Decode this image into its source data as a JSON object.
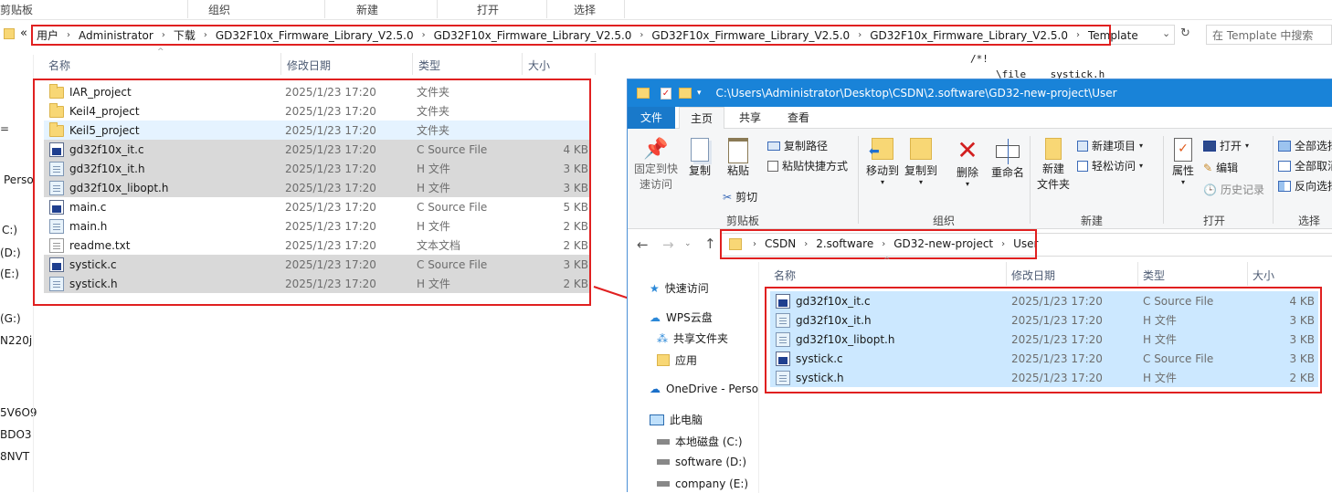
{
  "back_window": {
    "ribbon_groups": [
      "剪贴板",
      "组织",
      "新建",
      "打开",
      "选择"
    ],
    "address_prefix": "«",
    "breadcrumb": [
      "用户",
      "Administrator",
      "下载",
      "GD32F10x_Firmware_Library_V2.5.0",
      "GD32F10x_Firmware_Library_V2.5.0",
      "GD32F10x_Firmware_Library_V2.5.0",
      "GD32F10x_Firmware_Library_V2.5.0",
      "Template"
    ],
    "search_placeholder": "在 Template 中搜索",
    "columns": {
      "name": "名称",
      "date": "修改日期",
      "type": "类型",
      "size": "大小"
    },
    "files": [
      {
        "name": "IAR_project",
        "date": "2025/1/23 17:20",
        "type": "文件夹",
        "size": "",
        "icon": "folder-icon",
        "state": "normal"
      },
      {
        "name": "Keil4_project",
        "date": "2025/1/23 17:20",
        "type": "文件夹",
        "size": "",
        "icon": "folder-icon",
        "state": "normal"
      },
      {
        "name": "Keil5_project",
        "date": "2025/1/23 17:20",
        "type": "文件夹",
        "size": "",
        "icon": "folder-icon",
        "state": "hover"
      },
      {
        "name": "gd32f10x_it.c",
        "date": "2025/1/23 17:20",
        "type": "C Source File",
        "size": "4 KB",
        "icon": "c-source-icon",
        "state": "selected"
      },
      {
        "name": "gd32f10x_it.h",
        "date": "2025/1/23 17:20",
        "type": "H 文件",
        "size": "3 KB",
        "icon": "h-file-icon",
        "state": "selected"
      },
      {
        "name": "gd32f10x_libopt.h",
        "date": "2025/1/23 17:20",
        "type": "H 文件",
        "size": "3 KB",
        "icon": "h-file-icon",
        "state": "selected"
      },
      {
        "name": "main.c",
        "date": "2025/1/23 17:20",
        "type": "C Source File",
        "size": "5 KB",
        "icon": "c-source-icon",
        "state": "normal"
      },
      {
        "name": "main.h",
        "date": "2025/1/23 17:20",
        "type": "H 文件",
        "size": "2 KB",
        "icon": "h-file-icon",
        "state": "normal"
      },
      {
        "name": "readme.txt",
        "date": "2025/1/23 17:20",
        "type": "文本文档",
        "size": "2 KB",
        "icon": "text-file-icon",
        "state": "normal"
      },
      {
        "name": "systick.c",
        "date": "2025/1/23 17:20",
        "type": "C Source File",
        "size": "3 KB",
        "icon": "c-source-icon",
        "state": "selected"
      },
      {
        "name": "systick.h",
        "date": "2025/1/23 17:20",
        "type": "H 文件",
        "size": "2 KB",
        "icon": "h-file-icon",
        "state": "selected"
      }
    ],
    "left_fragments": [
      "=",
      "Perso",
      "C:)",
      "(D:)",
      "(E:)",
      "(G:)",
      "N220j",
      "5V6O9",
      "BDO3",
      "8NVT"
    ],
    "code_fragments": [
      "/*!",
      "\\file    systick.h"
    ]
  },
  "front_window": {
    "title": "C:\\Users\\Administrator\\Desktop\\CSDN\\2.software\\GD32-new-project\\User",
    "tabs": [
      "文件",
      "主页",
      "共享",
      "查看"
    ],
    "ribbon": {
      "pin_label": "固定到快\n速访问",
      "copy_label": "复制",
      "paste_label": "粘贴",
      "copy_path": "复制路径",
      "paste_shortcut": "粘贴快捷方式",
      "cut": "剪切",
      "move_to": "移动到",
      "copy_to": "复制到",
      "delete": "删除",
      "rename": "重命名",
      "new_folder": "新建\n文件夹",
      "new_item": "新建项目",
      "easy_access": "轻松访问",
      "properties": "属性",
      "open": "打开",
      "edit": "编辑",
      "history": "历史记录",
      "select_all": "全部选择",
      "select_none": "全部取消",
      "invert": "反向选择",
      "groups": [
        "剪贴板",
        "组织",
        "新建",
        "打开",
        "选择"
      ]
    },
    "breadcrumb": [
      "CSDN",
      "2.software",
      "GD32-new-project",
      "User"
    ],
    "nav": [
      {
        "label": "快速访问",
        "icon": "star-icon"
      },
      {
        "label": "WPS云盘",
        "icon": "cloud-icon"
      },
      {
        "label": "共享文件夹",
        "icon": "share-icon"
      },
      {
        "label": "应用",
        "icon": "folder-icon"
      },
      {
        "label": "OneDrive - Perso",
        "icon": "onedrive-icon"
      },
      {
        "label": "此电脑",
        "icon": "pc-icon"
      },
      {
        "label": "本地磁盘 (C:)",
        "icon": "drive-icon"
      },
      {
        "label": "software (D:)",
        "icon": "drive-icon"
      },
      {
        "label": "company (E:)",
        "icon": "drive-icon"
      }
    ],
    "columns": {
      "name": "名称",
      "date": "修改日期",
      "type": "类型",
      "size": "大小"
    },
    "files": [
      {
        "name": "gd32f10x_it.c",
        "date": "2025/1/23 17:20",
        "type": "C Source File",
        "size": "4 KB",
        "icon": "c-source-icon"
      },
      {
        "name": "gd32f10x_it.h",
        "date": "2025/1/23 17:20",
        "type": "H 文件",
        "size": "3 KB",
        "icon": "h-file-icon"
      },
      {
        "name": "gd32f10x_libopt.h",
        "date": "2025/1/23 17:20",
        "type": "H 文件",
        "size": "3 KB",
        "icon": "h-file-icon"
      },
      {
        "name": "systick.c",
        "date": "2025/1/23 17:20",
        "type": "C Source File",
        "size": "3 KB",
        "icon": "c-source-icon"
      },
      {
        "name": "systick.h",
        "date": "2025/1/23 17:20",
        "type": "H 文件",
        "size": "2 KB",
        "icon": "h-file-icon"
      }
    ]
  },
  "colors": {
    "highlight_box": "#e02020",
    "selection": "#cce8ff",
    "titlebar": "#1983d8"
  }
}
